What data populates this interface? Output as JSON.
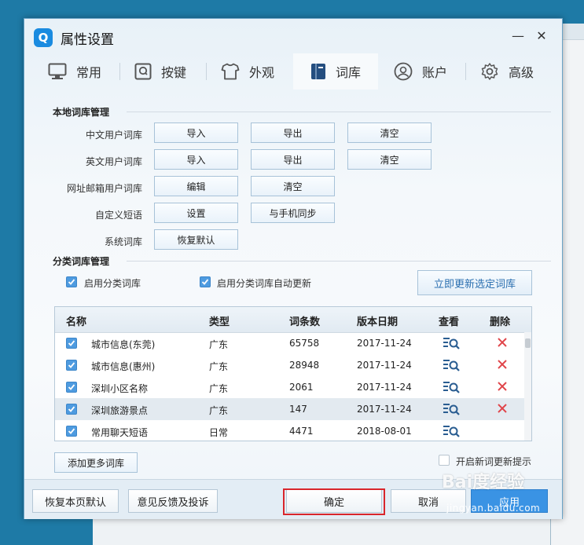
{
  "window": {
    "title": "属性设置",
    "logo_letter": "Q",
    "minimize": "—",
    "close": "✕"
  },
  "tabs": [
    {
      "label": "常用",
      "icon": "monitor-icon"
    },
    {
      "label": "按键",
      "icon": "key-icon"
    },
    {
      "label": "外观",
      "icon": "shirt-icon"
    },
    {
      "label": "词库",
      "icon": "book-icon",
      "active": true
    },
    {
      "label": "账户",
      "icon": "user-icon"
    },
    {
      "label": "高级",
      "icon": "gear-icon"
    }
  ],
  "local": {
    "title": "本地词库管理",
    "rows": [
      {
        "label": "中文用户词库",
        "buttons": [
          "导入",
          "导出",
          "清空"
        ]
      },
      {
        "label": "英文用户词库",
        "buttons": [
          "导入",
          "导出",
          "清空"
        ]
      },
      {
        "label": "网址邮箱用户词库",
        "buttons": [
          "编辑",
          "清空"
        ]
      },
      {
        "label": "自定义短语",
        "buttons": [
          "设置",
          "与手机同步"
        ]
      },
      {
        "label": "系统词库",
        "buttons": [
          "恢复默认"
        ]
      }
    ]
  },
  "category": {
    "title": "分类词库管理",
    "enable_label": "启用分类词库",
    "auto_update_label": "启用分类词库自动更新",
    "update_now": "立即更新选定词库",
    "columns": [
      "名称",
      "类型",
      "词条数",
      "版本日期",
      "查看",
      "删除"
    ],
    "rows": [
      {
        "name": "城市信息(东莞)",
        "type": "广东",
        "count": "65758",
        "date": "2017-11-24",
        "deletable": true
      },
      {
        "name": "城市信息(惠州)",
        "type": "广东",
        "count": "28948",
        "date": "2017-11-24",
        "deletable": true
      },
      {
        "name": "深圳小区名称",
        "type": "广东",
        "count": "2061",
        "date": "2017-11-24",
        "deletable": true
      },
      {
        "name": "深圳旅游景点",
        "type": "广东",
        "count": "147",
        "date": "2017-11-24",
        "deletable": true
      },
      {
        "name": "常用聊天短语",
        "type": "日常",
        "count": "4471",
        "date": "2018-08-01",
        "deletable": false
      }
    ],
    "add_more": "添加更多词库",
    "new_word_hint": "开启新词更新提示"
  },
  "footer": {
    "restore": "恢复本页默认",
    "feedback": "意见反馈及投诉",
    "ok": "确定",
    "cancel": "取消",
    "apply": "应用"
  },
  "watermark": {
    "text": "Bai度经验",
    "url": "jingyan.baidu.com"
  },
  "colors": {
    "accent": "#3a93e4",
    "check": "#4e9be0",
    "delete": "#e0454a",
    "highlight": "#d9262c"
  }
}
